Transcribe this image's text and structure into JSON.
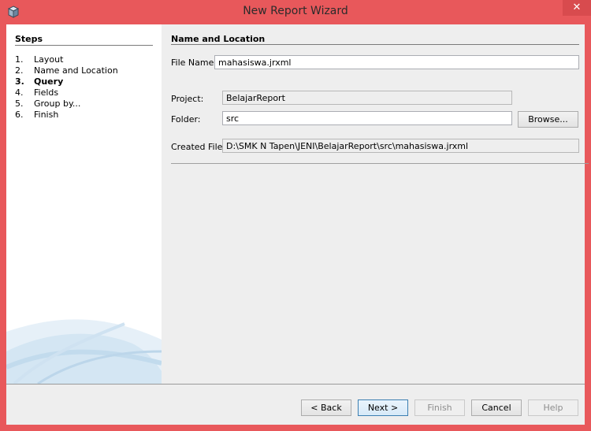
{
  "window": {
    "title": "New Report Wizard",
    "close_glyph": "✕",
    "app_icon": "cube-icon",
    "accent_color": "#e8585b"
  },
  "steps": {
    "title": "Steps",
    "items": [
      {
        "num": "1.",
        "label": "Layout",
        "active": false
      },
      {
        "num": "2.",
        "label": "Name and Location",
        "active": false
      },
      {
        "num": "3.",
        "label": "Query",
        "active": true
      },
      {
        "num": "4.",
        "label": "Fields",
        "active": false
      },
      {
        "num": "5.",
        "label": "Group by...",
        "active": false
      },
      {
        "num": "6.",
        "label": "Finish",
        "active": false
      }
    ]
  },
  "main": {
    "title": "Name and Location",
    "file_name_label": "File Name:",
    "file_name_value": "mahasiswa.jrxml",
    "project_label": "Project:",
    "project_value": "BelajarReport",
    "folder_label": "Folder:",
    "folder_value": "src",
    "browse_label": "Browse...",
    "created_file_label": "Created File:",
    "created_file_value": "D:\\SMK N Tapen\\JENI\\BelajarReport\\src\\mahasiswa.jrxml"
  },
  "footer": {
    "back_label": "< Back",
    "next_label": "Next >",
    "finish_label": "Finish",
    "cancel_label": "Cancel",
    "help_label": "Help"
  }
}
